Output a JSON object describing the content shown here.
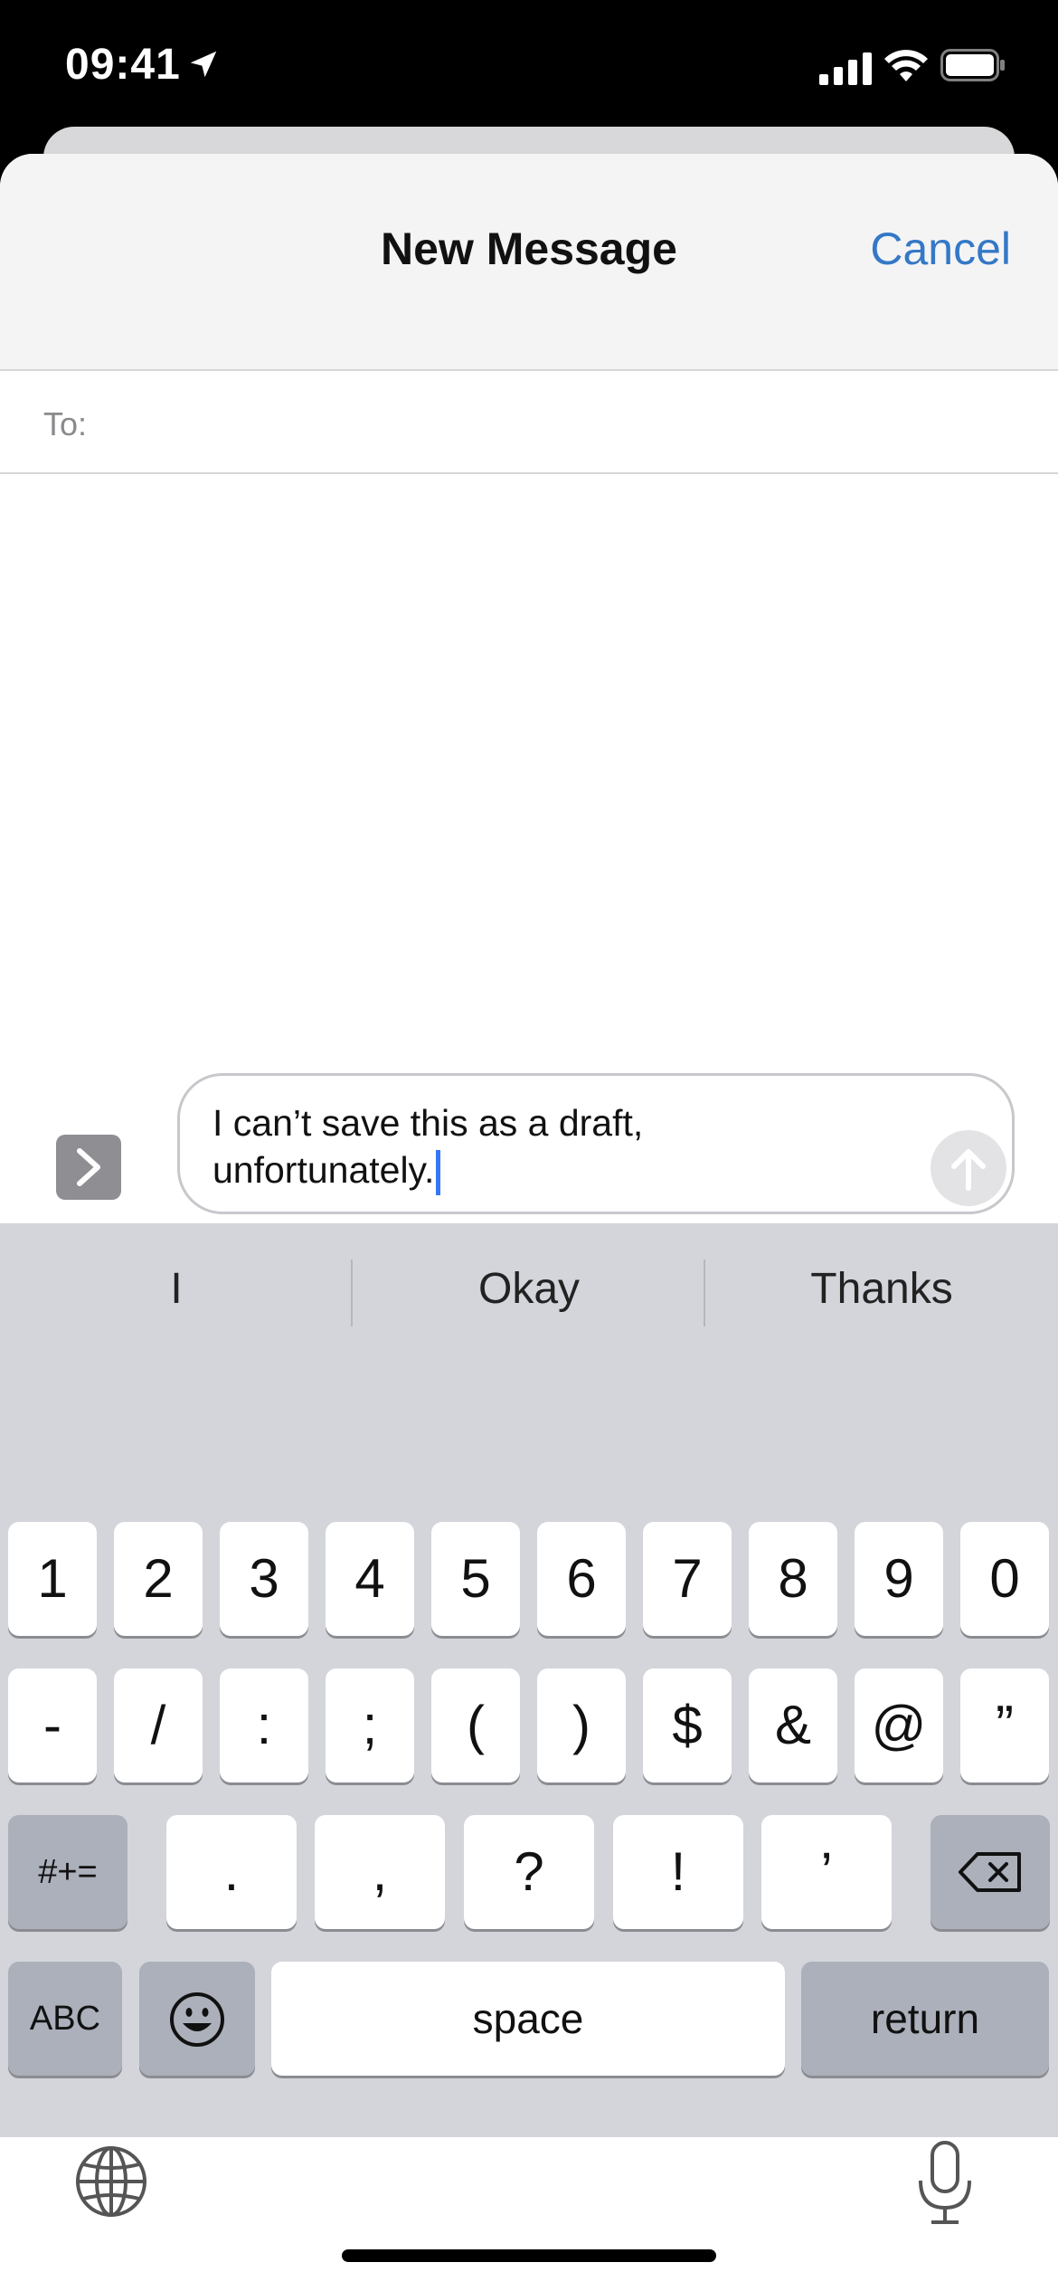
{
  "status": {
    "time": "09:41"
  },
  "header": {
    "title": "New Message",
    "cancel_label": "Cancel"
  },
  "to_field": {
    "label": "To:",
    "value": ""
  },
  "compose": {
    "text_line1": "I can’t save this as a draft,",
    "text_line2": "unfortunately."
  },
  "keyboard": {
    "suggestions": [
      "I",
      "Okay",
      "Thanks"
    ],
    "row1": [
      "1",
      "2",
      "3",
      "4",
      "5",
      "6",
      "7",
      "8",
      "9",
      "0"
    ],
    "row2": [
      "-",
      "/",
      ":",
      ";",
      "(",
      ")",
      "$",
      "&",
      "@",
      "”"
    ],
    "row3_special": "#+=",
    "row3": [
      ".",
      ",",
      "?",
      "!",
      "’"
    ],
    "abc_label": "ABC",
    "space_label": "space",
    "return_label": "return"
  },
  "icons": [
    "location-arrow-icon",
    "signal-icon",
    "wifi-icon",
    "battery-icon",
    "chevron-right-icon",
    "send-arrow-icon",
    "delete-icon",
    "emoji-icon",
    "globe-icon",
    "microphone-icon"
  ],
  "colors": {
    "accent": "#3478c6",
    "keyboard_bg": "#d3d5db",
    "key_dark": "#abb0ba"
  }
}
